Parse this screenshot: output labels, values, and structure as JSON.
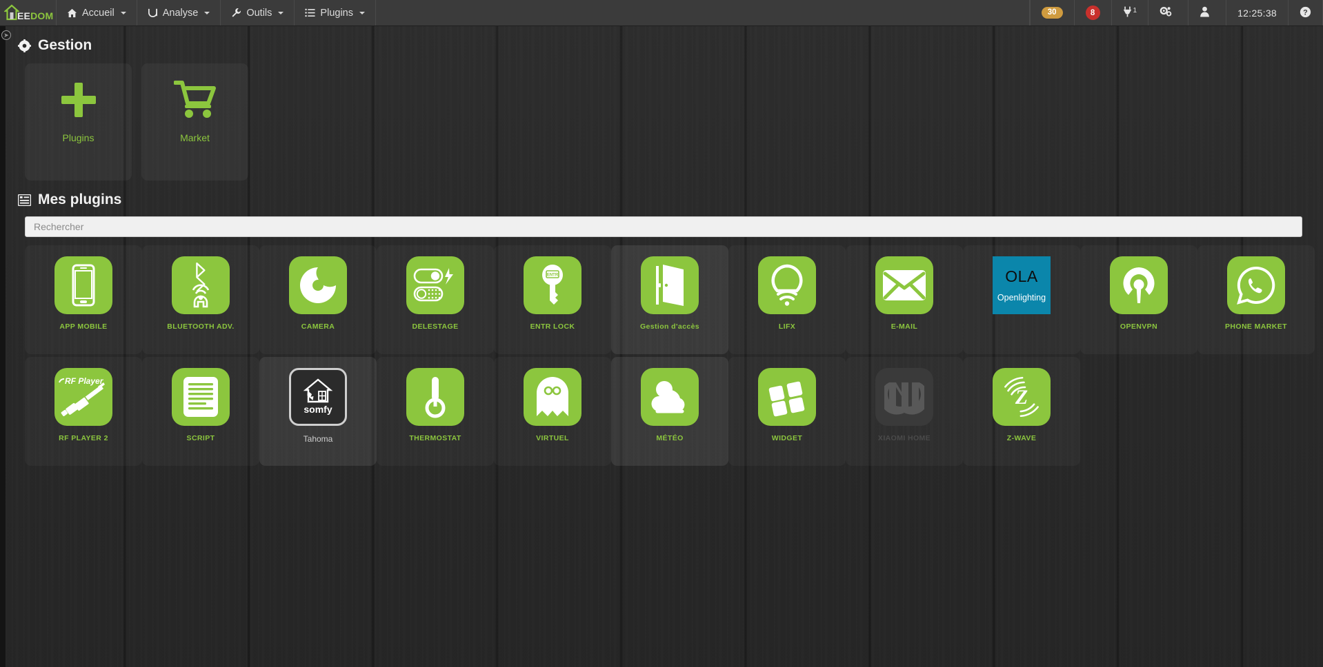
{
  "navbar": {
    "brand": {
      "white": "EE",
      "green": "DOM",
      "icon": "house-icon"
    },
    "menu": [
      {
        "label": "Accueil",
        "icon": "home-icon"
      },
      {
        "label": "Analyse",
        "icon": "analytics-icon"
      },
      {
        "label": "Outils",
        "icon": "wrench-icon"
      },
      {
        "label": "Plugins",
        "icon": "list-icon"
      }
    ],
    "right": {
      "update_badge": "30",
      "alert_badge": "8",
      "plug_count": "1",
      "gear_icon": "gears-icon",
      "user_icon": "user-icon",
      "clock": "12:25:38",
      "help_icon": "help-circle-icon"
    }
  },
  "management": {
    "title": "Gestion",
    "title_icon": "gear-icon",
    "tiles": [
      {
        "label": "Plugins",
        "icon": "plus-icon"
      },
      {
        "label": "Market",
        "icon": "shopping-cart-icon"
      }
    ]
  },
  "my_plugins": {
    "title": "Mes plugins",
    "title_icon": "table-icon",
    "search_placeholder": "Rechercher",
    "search_value": "",
    "items": [
      {
        "label": "APP MOBILE",
        "icon": "smartphone-icon",
        "style": "green"
      },
      {
        "label": "BLUETOOTH ADV.",
        "icon": "bluetooth-presence-icon",
        "style": "green"
      },
      {
        "label": "CAMERA",
        "icon": "camera-shutter-icon",
        "style": "green"
      },
      {
        "label": "DELESTAGE",
        "icon": "toggle-switches-icon",
        "style": "green"
      },
      {
        "label": "ENTR LOCK",
        "icon": "key-icon",
        "style": "green"
      },
      {
        "label": "Gestion d'accès",
        "icon": "open-door-icon",
        "style": "green",
        "highlighted": true
      },
      {
        "label": "LIFX",
        "icon": "lightbulb-wifi-icon",
        "style": "green"
      },
      {
        "label": "E-MAIL",
        "icon": "envelope-icon",
        "style": "green"
      },
      {
        "label": "",
        "icon": "ola-openlighting-icon",
        "style": "ola",
        "ola_top": "OLA",
        "ola_bottom": "Openlighting"
      },
      {
        "label": "OPENVPN",
        "icon": "openvpn-icon",
        "style": "green"
      },
      {
        "label": "PHONE MARKET",
        "icon": "whatsapp-phone-icon",
        "style": "green"
      },
      {
        "label": "RF PLAYER 2",
        "icon": "rf-player-dongle-icon",
        "style": "green",
        "inner_text": "RF Player"
      },
      {
        "label": "SCRIPT",
        "icon": "document-lines-icon",
        "style": "green"
      },
      {
        "label": "Tahoma",
        "icon": "somfy-tahoma-icon",
        "style": "dark",
        "inner_text": "somfy",
        "label_plain": true
      },
      {
        "label": "THERMOSTAT",
        "icon": "thermometer-icon",
        "style": "green"
      },
      {
        "label": "VIRTUEL",
        "icon": "ghost-icon",
        "style": "green"
      },
      {
        "label": "MÉTÉO",
        "icon": "cloud-sun-icon",
        "style": "green",
        "highlighted": true
      },
      {
        "label": "WIDGET",
        "icon": "four-squares-icon",
        "style": "green"
      },
      {
        "label": "XIAOMI HOME",
        "icon": "xiaomi-mi-icon",
        "style": "disabled"
      },
      {
        "label": "Z-WAVE",
        "icon": "zwave-icon",
        "style": "green"
      }
    ]
  },
  "colors": {
    "accent_green": "#8cc63e",
    "badge_orange": "#cf9b3f",
    "badge_red": "#c9302c",
    "ola_blue": "#0b86ab",
    "navbar_bg": "#3b3b3b"
  }
}
